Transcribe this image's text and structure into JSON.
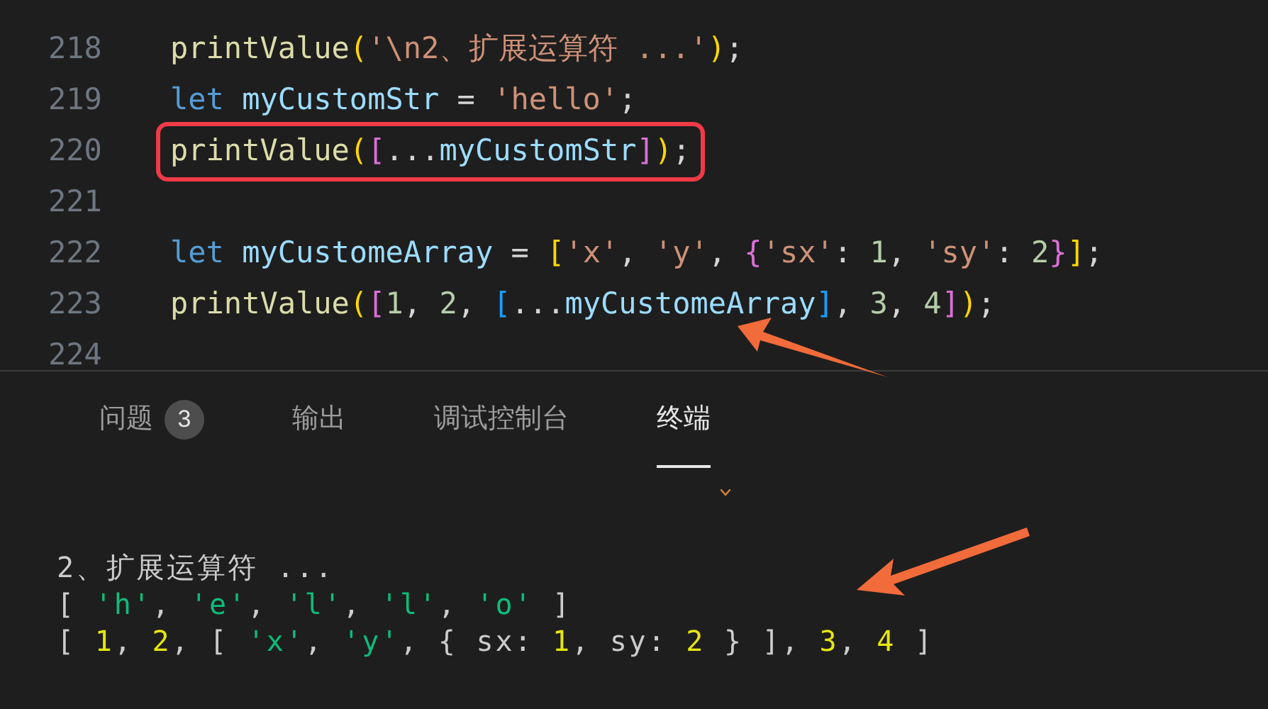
{
  "editor": {
    "lines": [
      {
        "number": "218",
        "highlighted": false,
        "tokens": [
          {
            "kind": "fn",
            "text": "printValue"
          },
          {
            "kind": "paren",
            "text": "("
          },
          {
            "kind": "str",
            "text": "'\\n2、扩展运算符 ...'"
          },
          {
            "kind": "paren",
            "text": ")"
          },
          {
            "kind": "punc",
            "text": ";"
          }
        ]
      },
      {
        "number": "219",
        "highlighted": false,
        "tokens": [
          {
            "kind": "kw",
            "text": "let"
          },
          {
            "kind": "var",
            "text": "myCustomStr",
            "space_before": true
          },
          {
            "kind": "punc",
            "text": " = "
          },
          {
            "kind": "str",
            "text": "'hello'"
          },
          {
            "kind": "punc",
            "text": ";"
          }
        ]
      },
      {
        "number": "220",
        "highlighted": true,
        "tokens": [
          {
            "kind": "fn",
            "text": "printValue"
          },
          {
            "kind": "paren",
            "text": "("
          },
          {
            "kind": "bracket",
            "text": "["
          },
          {
            "kind": "punc",
            "text": "..."
          },
          {
            "kind": "var",
            "text": "myCustomStr"
          },
          {
            "kind": "bracket",
            "text": "]"
          },
          {
            "kind": "paren",
            "text": ")"
          },
          {
            "kind": "punc",
            "text": ";"
          }
        ]
      },
      {
        "number": "221",
        "highlighted": false
      },
      {
        "number": "222",
        "highlighted": false,
        "tokens": [
          {
            "kind": "kw",
            "text": "let"
          },
          {
            "kind": "var",
            "text": "myCustomeArray",
            "space_before": true
          },
          {
            "kind": "punc",
            "text": " = "
          },
          {
            "kind": "paren",
            "text": "["
          },
          {
            "kind": "str",
            "text": "'x'"
          },
          {
            "kind": "punc",
            "text": ", "
          },
          {
            "kind": "str",
            "text": "'y'"
          },
          {
            "kind": "punc",
            "text": ", "
          },
          {
            "kind": "bracket",
            "text": "{"
          },
          {
            "kind": "str",
            "text": "'sx'"
          },
          {
            "kind": "punc",
            "text": ": "
          },
          {
            "kind": "num",
            "text": "1"
          },
          {
            "kind": "punc",
            "text": ", "
          },
          {
            "kind": "str",
            "text": "'sy'"
          },
          {
            "kind": "punc",
            "text": ": "
          },
          {
            "kind": "num",
            "text": "2"
          },
          {
            "kind": "bracket",
            "text": "}"
          },
          {
            "kind": "paren",
            "text": "]"
          },
          {
            "kind": "punc",
            "text": ";"
          }
        ]
      },
      {
        "number": "223",
        "highlighted": false,
        "tokens": [
          {
            "kind": "fn",
            "text": "printValue"
          },
          {
            "kind": "paren",
            "text": "("
          },
          {
            "kind": "bracket",
            "text": "["
          },
          {
            "kind": "num",
            "text": "1"
          },
          {
            "kind": "punc",
            "text": ", "
          },
          {
            "kind": "num",
            "text": "2"
          },
          {
            "kind": "punc",
            "text": ", "
          },
          {
            "kind": "blue",
            "text": "["
          },
          {
            "kind": "punc",
            "text": "..."
          },
          {
            "kind": "var",
            "text": "myCustomeArray"
          },
          {
            "kind": "blue",
            "text": "]"
          },
          {
            "kind": "punc",
            "text": ", "
          },
          {
            "kind": "num",
            "text": "3"
          },
          {
            "kind": "punc",
            "text": ", "
          },
          {
            "kind": "num",
            "text": "4"
          },
          {
            "kind": "bracket",
            "text": "]"
          },
          {
            "kind": "paren",
            "text": ")"
          },
          {
            "kind": "punc",
            "text": ";"
          }
        ]
      },
      {
        "number": "224",
        "highlighted": false
      }
    ]
  },
  "panel": {
    "tabs": [
      {
        "label": "问题",
        "badge": "3",
        "selected": false
      },
      {
        "label": "输出",
        "selected": false
      },
      {
        "label": "调试控制台",
        "selected": false
      },
      {
        "label": "终端",
        "selected": true
      }
    ],
    "terminal": [
      [
        {
          "kind": "plain",
          "text": "2、扩展运算符 ..."
        }
      ],
      [
        {
          "kind": "plain",
          "text": "[ "
        },
        {
          "kind": "str",
          "text": "'h'"
        },
        {
          "kind": "plain",
          "text": ", "
        },
        {
          "kind": "str",
          "text": "'e'"
        },
        {
          "kind": "plain",
          "text": ", "
        },
        {
          "kind": "str",
          "text": "'l'"
        },
        {
          "kind": "plain",
          "text": ", "
        },
        {
          "kind": "str",
          "text": "'l'"
        },
        {
          "kind": "plain",
          "text": ", "
        },
        {
          "kind": "str",
          "text": "'o'"
        },
        {
          "kind": "plain",
          "text": " ]"
        }
      ],
      [
        {
          "kind": "plain",
          "text": "[ "
        },
        {
          "kind": "num",
          "text": "1"
        },
        {
          "kind": "plain",
          "text": ", "
        },
        {
          "kind": "num",
          "text": "2"
        },
        {
          "kind": "plain",
          "text": ", [ "
        },
        {
          "kind": "str",
          "text": "'x'"
        },
        {
          "kind": "plain",
          "text": ", "
        },
        {
          "kind": "str",
          "text": "'y'"
        },
        {
          "kind": "plain",
          "text": ", { sx: "
        },
        {
          "kind": "num",
          "text": "1"
        },
        {
          "kind": "plain",
          "text": ", sy: "
        },
        {
          "kind": "num",
          "text": "2"
        },
        {
          "kind": "plain",
          "text": " } ], "
        },
        {
          "kind": "num",
          "text": "3"
        },
        {
          "kind": "plain",
          "text": ", "
        },
        {
          "kind": "num",
          "text": "4"
        },
        {
          "kind": "plain",
          "text": " ]"
        }
      ]
    ]
  }
}
